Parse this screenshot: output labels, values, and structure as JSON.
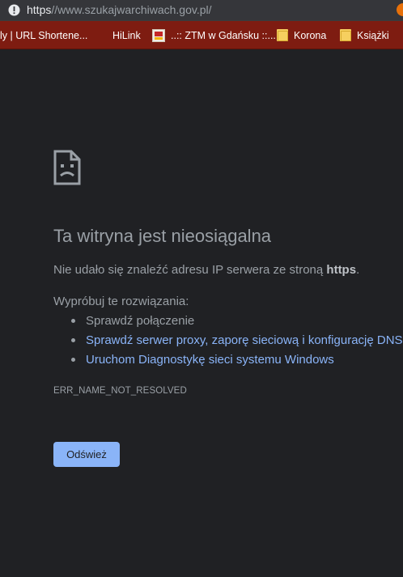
{
  "addressbar": {
    "url_scheme": "https",
    "url_rest": "//www.szukajwarchiwach.gov.pl/",
    "info_icon": "info-icon"
  },
  "bookmarks": [
    {
      "label": "ly | URL Shortene...",
      "icon": "none"
    },
    {
      "label": "HiLink",
      "icon": "none"
    },
    {
      "label": "..:: ZTM w Gdańsku ::...",
      "icon": "ztm-icon"
    },
    {
      "label": "Korona",
      "icon": "folder-icon"
    },
    {
      "label": "Książki",
      "icon": "folder-icon"
    }
  ],
  "error": {
    "icon": "sad-page-icon",
    "title": "Ta witryna jest nieosiągalna",
    "summary_prefix": "Nie udało się znaleźć adresu IP serwera ze stroną ",
    "summary_host": "https",
    "summary_suffix": ".",
    "suggestions_heading": "Wypróbuj te rozwiązania:",
    "suggestions": [
      "Sprawdź połączenie",
      "Sprawdź serwer proxy, zaporę sieciową i konfigurację DNS",
      "Uruchom Diagnostykę sieci systemu Windows"
    ],
    "code": "ERR_NAME_NOT_RESOLVED",
    "reload_label": "Odśwież"
  },
  "colors": {
    "page_bg": "#202124",
    "bookmarks_bg": "#7e1c11",
    "link": "#8ab4f8",
    "text": "#9aa0a6"
  }
}
